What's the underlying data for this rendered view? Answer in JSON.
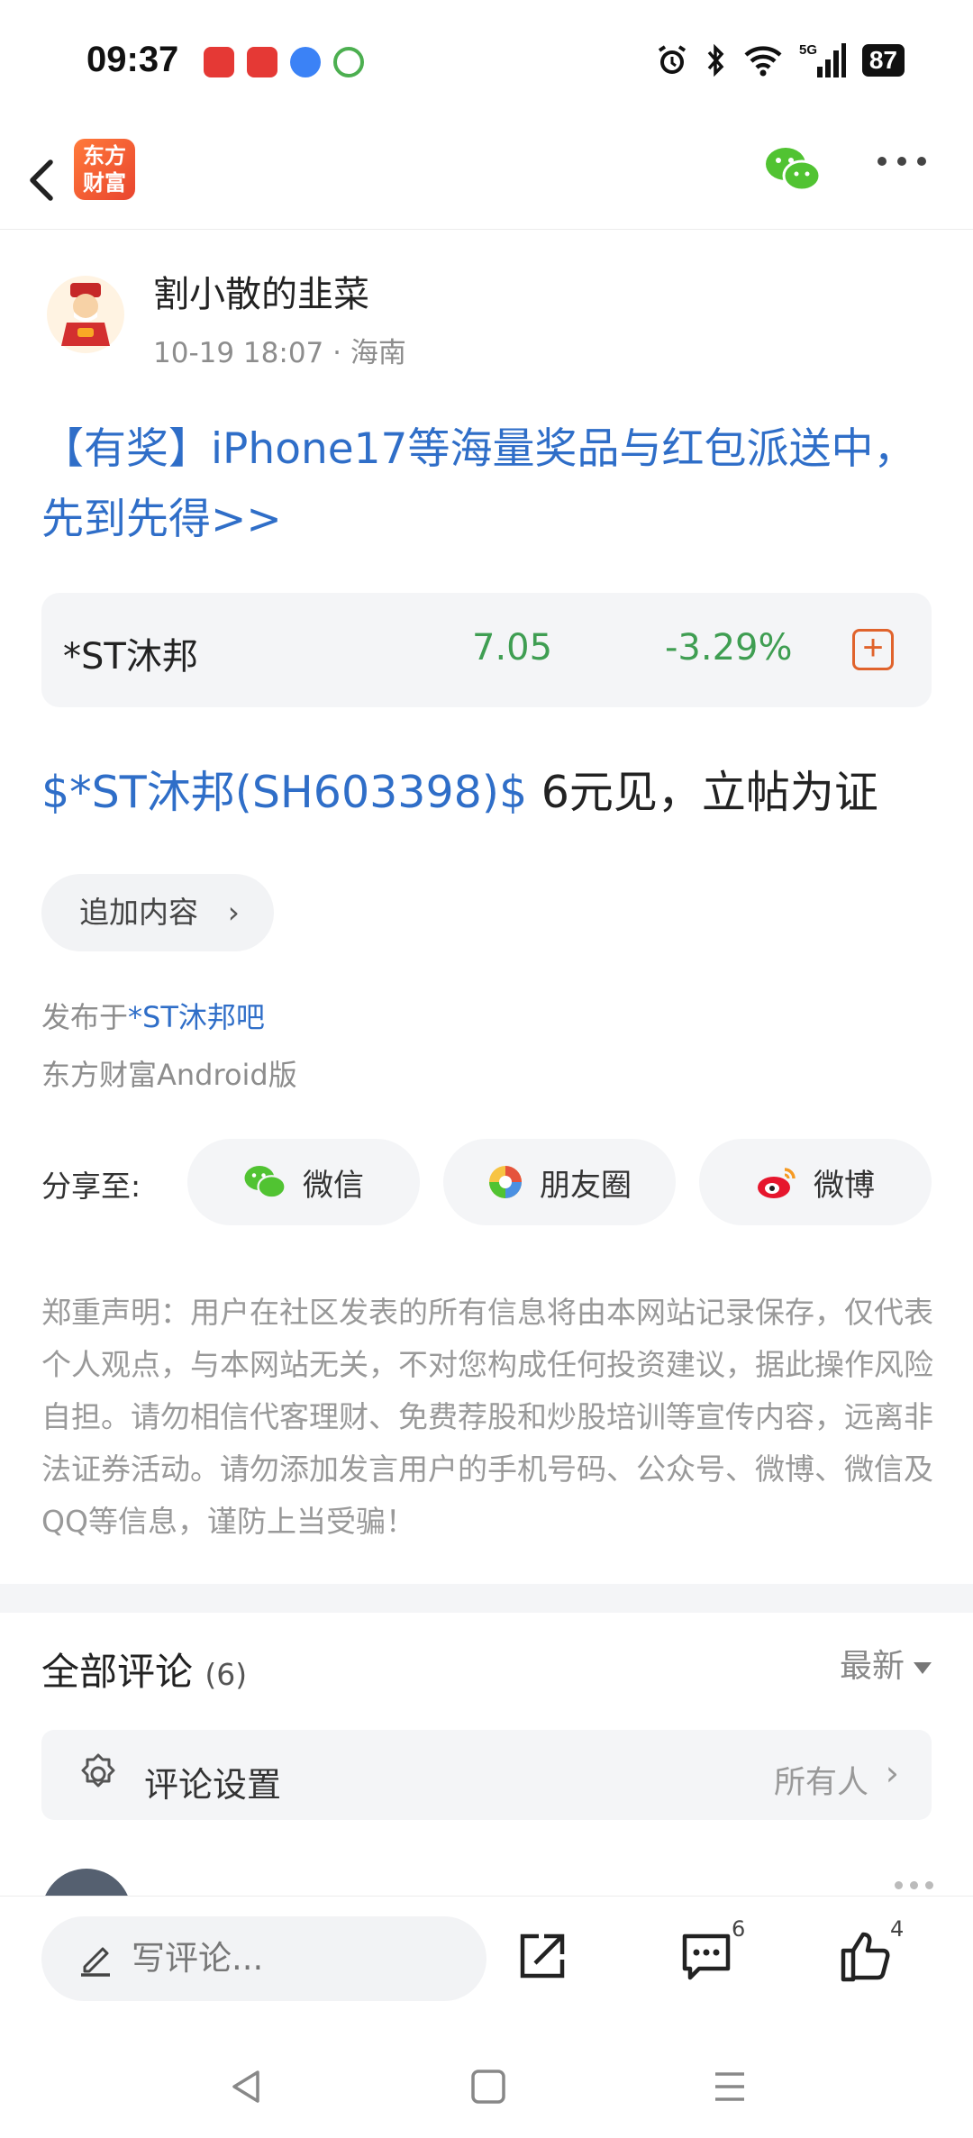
{
  "status_bar": {
    "time": "09:37",
    "battery": "87",
    "network": "5G"
  },
  "header": {
    "logo_text": "东方财富",
    "logo_line1": "东方",
    "logo_line2": "财富"
  },
  "author": {
    "name": "割小散的韭菜",
    "meta": "10-19 18:07 · 海南"
  },
  "promo": {
    "text": "【有奖】iPhone17等海量奖品与红包派送中，先到先得>>"
  },
  "stock": {
    "name": "*ST沐邦",
    "price": "7.05",
    "change": "-3.29%",
    "add_label": "+"
  },
  "post": {
    "tag": "$*ST沐邦(SH603398)$",
    "text": " 6元见，立帖为证"
  },
  "append": {
    "label": "追加内容",
    "chevron": "›"
  },
  "publish": {
    "prefix": "发布于",
    "bar": "*ST沐邦吧",
    "client": "东方财富Android版"
  },
  "share": {
    "label": "分享至:",
    "wechat": "微信",
    "moments": "朋友圈",
    "weibo": "微博"
  },
  "disclaimer": "郑重声明：用户在社区发表的所有信息将由本网站记录保存，仅代表个人观点，与本网站无关，不对您构成任何投资建议，据此操作风险自担。请勿相信代客理财、免费荐股和炒股培训等宣传内容，远离非法证券活动。请勿添加发言用户的手机号码、公众号、微博、微信及QQ等信息，谨防上当受骗！",
  "comments": {
    "title": "全部评论",
    "count": "(6)",
    "sort": "最新",
    "settings_label": "评论设置",
    "settings_value": "所有人",
    "settings_chevron": "›"
  },
  "bottom_bar": {
    "input_placeholder": "写评论...",
    "comment_count": "6",
    "like_count": "4"
  },
  "colors": {
    "link_blue": "#2f6ec8",
    "stock_green": "#3f9e52",
    "accent_orange": "#e0632c"
  }
}
